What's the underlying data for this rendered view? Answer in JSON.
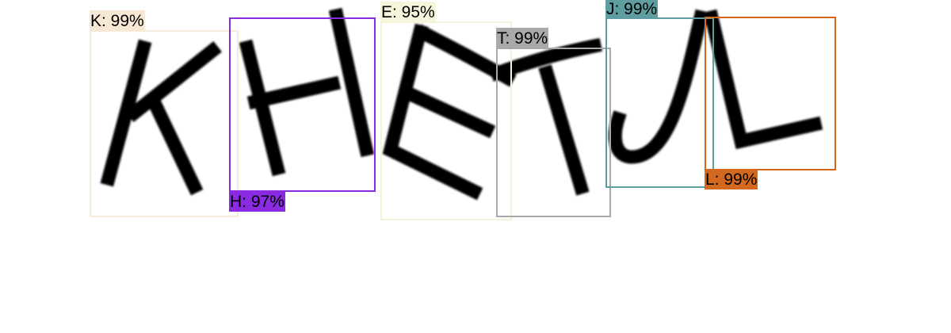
{
  "detections": [
    {
      "char": "K",
      "label": "K: 99%",
      "score": 0.99,
      "color": "#f5e9d9"
    },
    {
      "char": "H",
      "label": "H: 97%",
      "score": 0.97,
      "color": "#8a2be2"
    },
    {
      "char": "E",
      "label": "E: 95%",
      "score": 0.95,
      "color": "#f5f5dc"
    },
    {
      "char": "T",
      "label": "T: 99%",
      "score": 0.99,
      "color": "#a9a9a9"
    },
    {
      "char": "J",
      "label": "J: 99%",
      "score": 0.99,
      "color": "#5f9ea0"
    },
    {
      "char": "L",
      "label": "L: 99%",
      "score": 0.99,
      "color": "#d2691e"
    }
  ]
}
